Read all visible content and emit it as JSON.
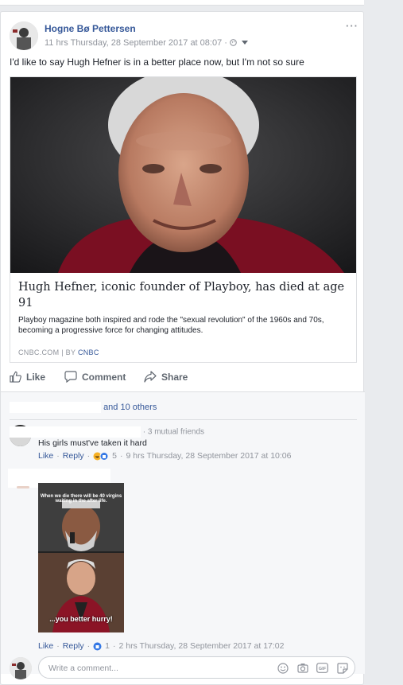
{
  "post": {
    "author": "Hogne Bø Pettersen",
    "timestamp": "11 hrs Thursday, 28 September 2017 at 08:07",
    "privacy_icon": "globe-icon",
    "text": "I'd like to say Hugh Hefner is in a better place now, but I'm not so sure"
  },
  "link": {
    "title": "Hugh Hefner, iconic founder of Playboy, has died at age 91",
    "description": "Playboy magazine both inspired and rode the \"sexual revolution\" of the 1960s and 70s, becoming a progressive force for changing attitudes.",
    "source": "CNBC.COM",
    "by_prefix": "BY",
    "by_name": "CNBC"
  },
  "actions": {
    "like": "Like",
    "comment": "Comment",
    "share": "Share"
  },
  "reactions": {
    "others": "and 10 others"
  },
  "comments": [
    {
      "mutual": "· 3 mutual friends",
      "text": "His girls must've taken it hard",
      "like": "Like",
      "reply": "Reply",
      "reaction_count": "5",
      "time": "9 hrs Thursday, 28 September 2017 at 10:06"
    },
    {
      "meme_top": "When we die there will be 40 virgins waiting in the after life.",
      "meme_bottom": "...you better hurry!",
      "like": "Like",
      "reply": "Reply",
      "reaction_count": "1",
      "time": "2 hrs Thursday, 28 September 2017 at 17:02"
    }
  ],
  "composer": {
    "placeholder": "Write a comment..."
  },
  "colors": {
    "link_blue": "#365899",
    "muted": "#90949c",
    "bg": "#e9ebee"
  }
}
